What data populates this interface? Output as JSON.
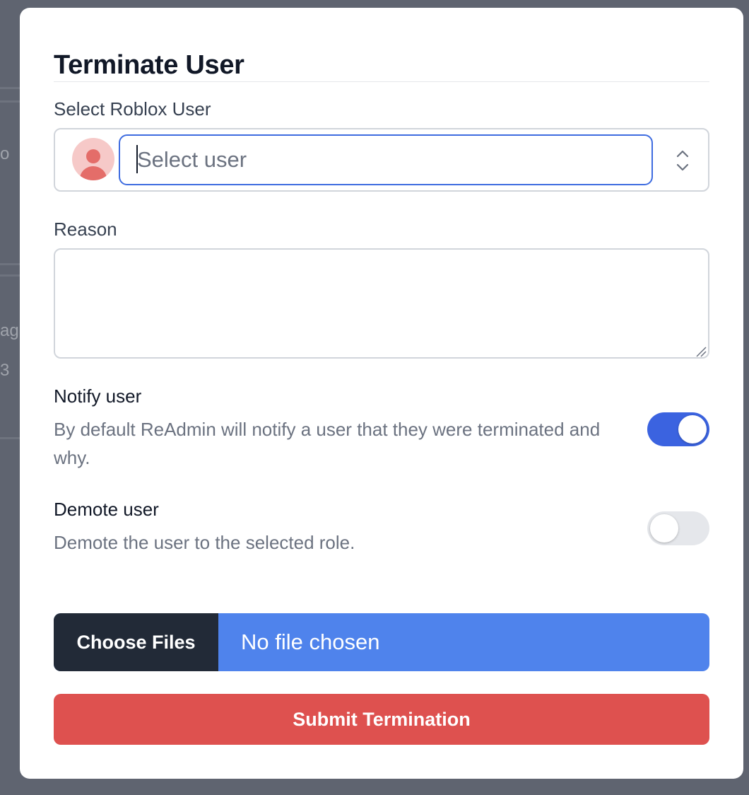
{
  "backdrop": {
    "fragments": [
      "o",
      "ag",
      "3"
    ]
  },
  "modal": {
    "title": "Terminate User",
    "select_user": {
      "label": "Select Roblox User",
      "placeholder": "Select user",
      "value": ""
    },
    "reason": {
      "label": "Reason",
      "value": ""
    },
    "notify": {
      "title": "Notify user",
      "description": "By default ReAdmin will notify a user that they were terminated and why.",
      "enabled": true
    },
    "demote": {
      "title": "Demote user",
      "description": "Demote the user to the selected role.",
      "enabled": false
    },
    "file_upload": {
      "button_label": "Choose Files",
      "status": "No file chosen"
    },
    "submit_label": "Submit Termination"
  },
  "colors": {
    "accent": "#3b63e0",
    "danger": "#de514f",
    "file_bar": "#4f83ec",
    "file_button": "#222a37"
  }
}
